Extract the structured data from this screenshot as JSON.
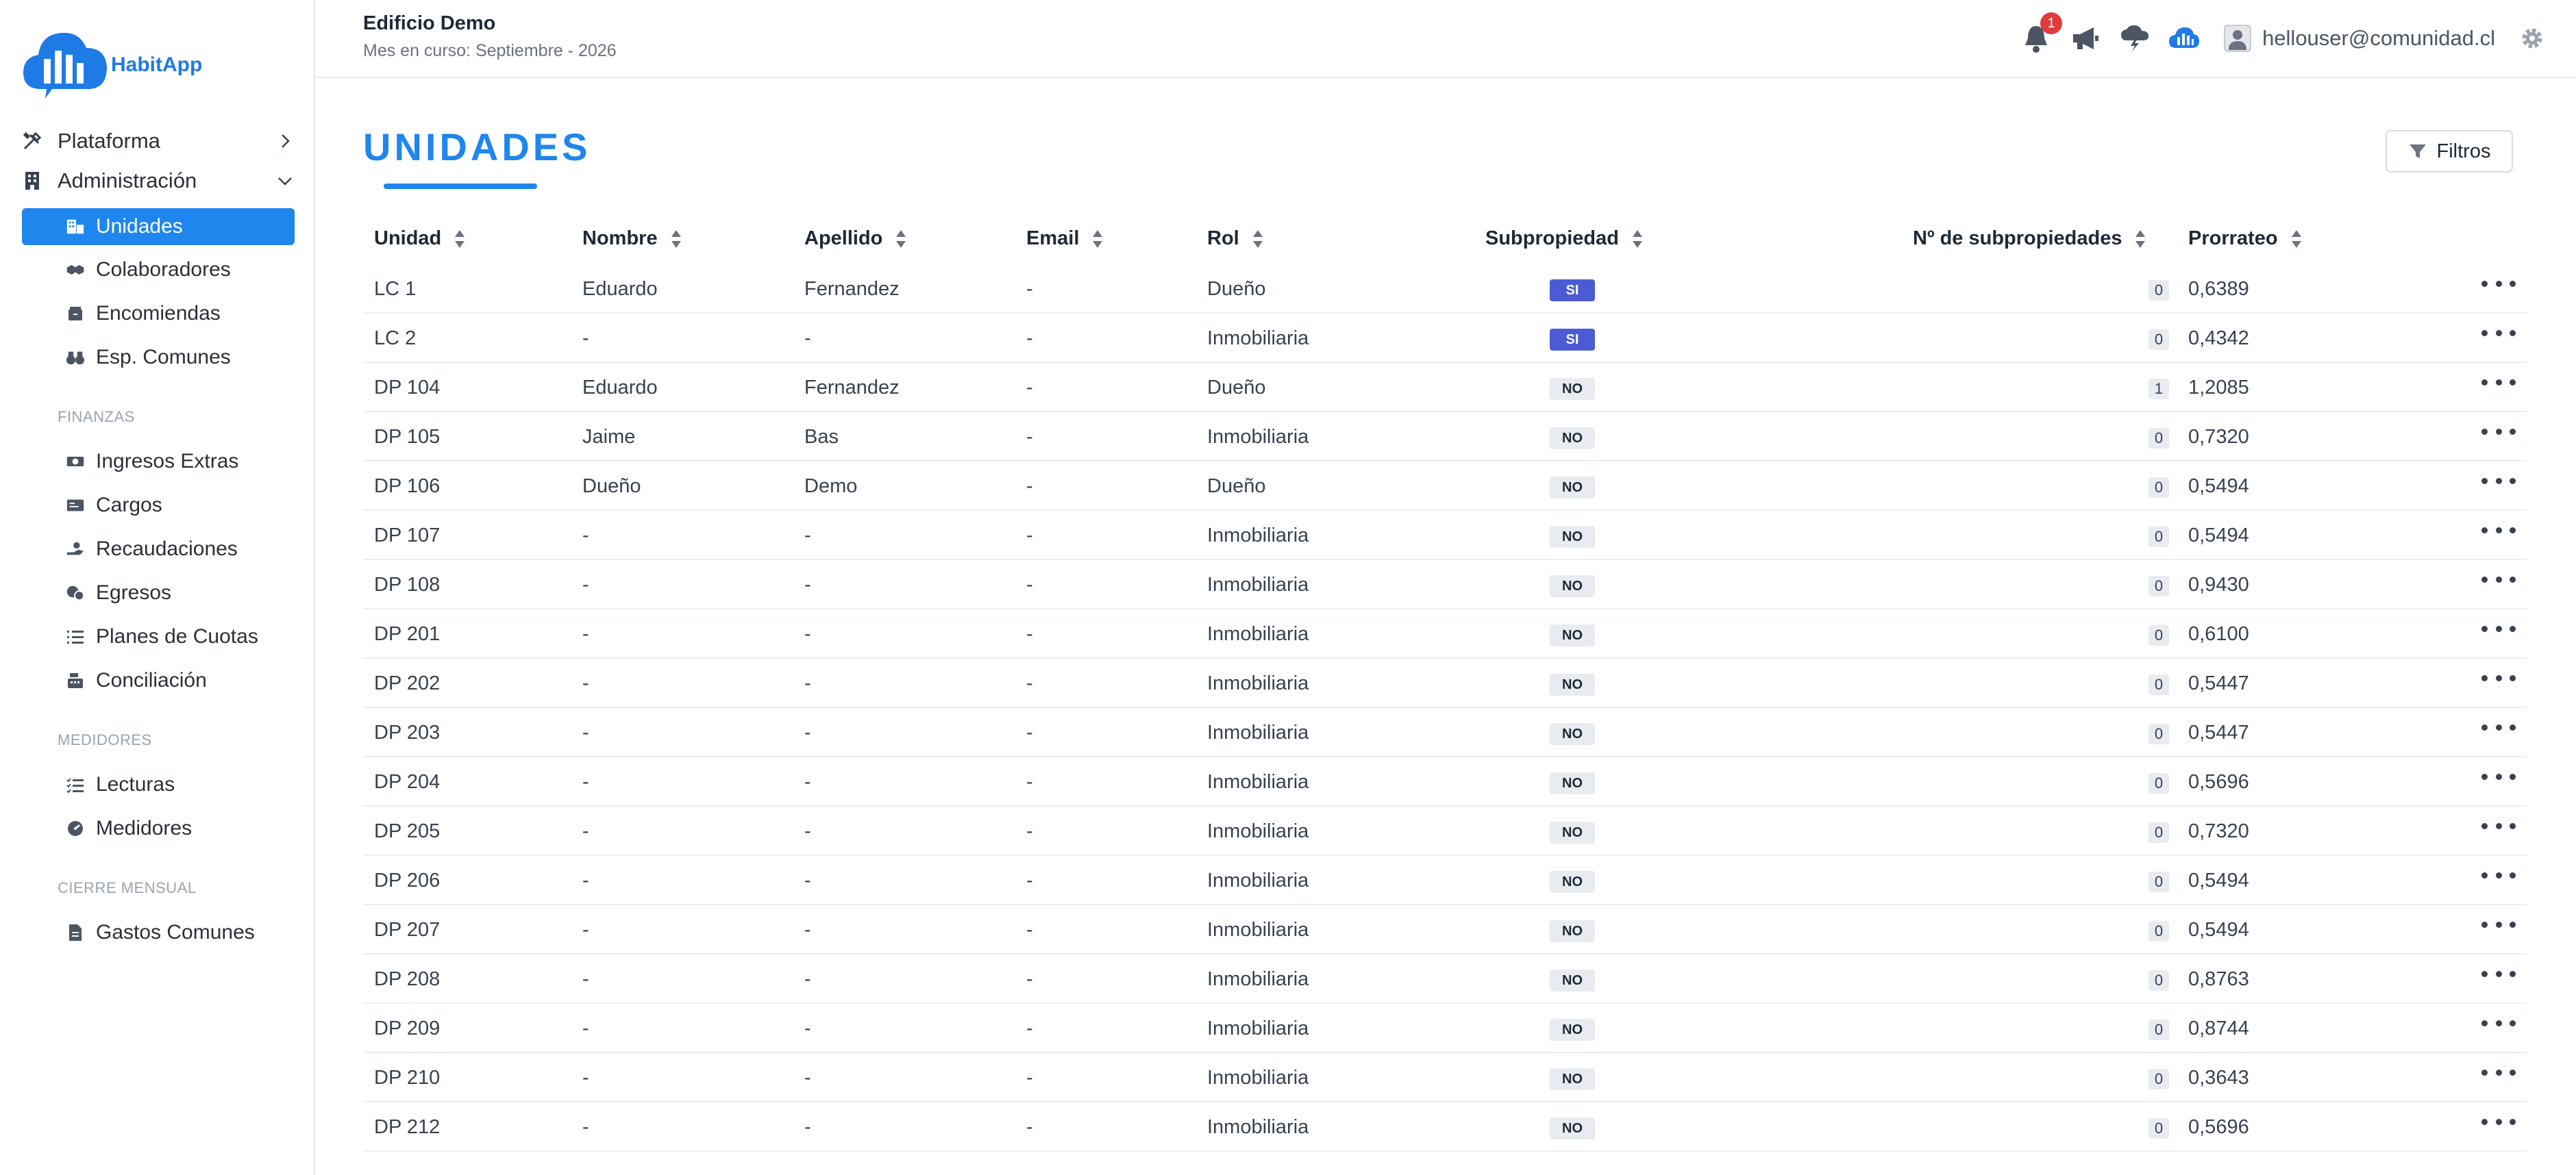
{
  "app": {
    "logo_text": "HabitApp"
  },
  "header": {
    "building": "Edificio Demo",
    "period": "Mes en curso: Septiembre - 2026",
    "notifications_count": "1",
    "user_email": "hellouser@comunidad.cl"
  },
  "sidebar": {
    "top": [
      {
        "label": "Plataforma",
        "icon": "tools-icon",
        "chevron": "chevron-right-icon"
      },
      {
        "label": "Administración",
        "icon": "building-icon",
        "chevron": "chevron-down-icon"
      }
    ],
    "admin_items": [
      {
        "label": "Unidades",
        "icon": "units-icon",
        "active": true
      },
      {
        "label": "Colaboradores",
        "icon": "handshake-icon"
      },
      {
        "label": "Encomiendas",
        "icon": "package-icon"
      },
      {
        "label": "Esp. Comunes",
        "icon": "binoculars-icon"
      }
    ],
    "finanzas_label": "FINANZAS",
    "finanzas_items": [
      {
        "label": "Ingresos Extras",
        "icon": "money-icon"
      },
      {
        "label": "Cargos",
        "icon": "card-icon"
      },
      {
        "label": "Recaudaciones",
        "icon": "hand-coin-icon"
      },
      {
        "label": "Egresos",
        "icon": "coins-icon"
      },
      {
        "label": "Planes de Cuotas",
        "icon": "list-icon"
      },
      {
        "label": "Conciliación",
        "icon": "cash-register-icon"
      }
    ],
    "medidores_label": "MEDIDORES",
    "medidores_items": [
      {
        "label": "Lecturas",
        "icon": "checklist-icon"
      },
      {
        "label": "Medidores",
        "icon": "gauge-icon"
      }
    ],
    "cierre_label": "CIERRE MENSUAL",
    "cierre_items": [
      {
        "label": "Gastos Comunes",
        "icon": "invoice-icon"
      }
    ]
  },
  "page": {
    "title": "UNIDADES",
    "filter_label": "Filtros"
  },
  "table": {
    "columns": [
      "Unidad",
      "Nombre",
      "Apellido",
      "Email",
      "Rol",
      "Subpropiedad",
      "Nº de subpropiedades",
      "Prorrateo"
    ],
    "rows": [
      [
        "LC 1",
        "Eduardo",
        "Fernandez",
        "-",
        "Dueño",
        "SI",
        "0",
        "0,6389"
      ],
      [
        "LC 2",
        "-",
        "-",
        "-",
        "Inmobiliaria",
        "SI",
        "0",
        "0,4342"
      ],
      [
        "DP 104",
        "Eduardo",
        "Fernandez",
        "-",
        "Dueño",
        "NO",
        "1",
        "1,2085"
      ],
      [
        "DP 105",
        "Jaime",
        "Bas",
        "-",
        "Inmobiliaria",
        "NO",
        "0",
        "0,7320"
      ],
      [
        "DP 106",
        "Dueño",
        "Demo",
        "-",
        "Dueño",
        "NO",
        "0",
        "0,5494"
      ],
      [
        "DP 107",
        "-",
        "-",
        "-",
        "Inmobiliaria",
        "NO",
        "0",
        "0,5494"
      ],
      [
        "DP 108",
        "-",
        "-",
        "-",
        "Inmobiliaria",
        "NO",
        "0",
        "0,9430"
      ],
      [
        "DP 201",
        "-",
        "-",
        "-",
        "Inmobiliaria",
        "NO",
        "0",
        "0,6100"
      ],
      [
        "DP 202",
        "-",
        "-",
        "-",
        "Inmobiliaria",
        "NO",
        "0",
        "0,5447"
      ],
      [
        "DP 203",
        "-",
        "-",
        "-",
        "Inmobiliaria",
        "NO",
        "0",
        "0,5447"
      ],
      [
        "DP 204",
        "-",
        "-",
        "-",
        "Inmobiliaria",
        "NO",
        "0",
        "0,5696"
      ],
      [
        "DP 205",
        "-",
        "-",
        "-",
        "Inmobiliaria",
        "NO",
        "0",
        "0,7320"
      ],
      [
        "DP 206",
        "-",
        "-",
        "-",
        "Inmobiliaria",
        "NO",
        "0",
        "0,5494"
      ],
      [
        "DP 207",
        "-",
        "-",
        "-",
        "Inmobiliaria",
        "NO",
        "0",
        "0,5494"
      ],
      [
        "DP 208",
        "-",
        "-",
        "-",
        "Inmobiliaria",
        "NO",
        "0",
        "0,8763"
      ],
      [
        "DP 209",
        "-",
        "-",
        "-",
        "Inmobiliaria",
        "NO",
        "0",
        "0,8744"
      ],
      [
        "DP 210",
        "-",
        "-",
        "-",
        "Inmobiliaria",
        "NO",
        "0",
        "0,3643"
      ],
      [
        "DP 212",
        "-",
        "-",
        "-",
        "Inmobiliaria",
        "NO",
        "0",
        "0,5696"
      ]
    ]
  },
  "colors": {
    "accent": "#1f86ee",
    "badge": "#e23b3b",
    "tag_si": "#4a5bd4",
    "tag_no": "#e8ebf0"
  }
}
